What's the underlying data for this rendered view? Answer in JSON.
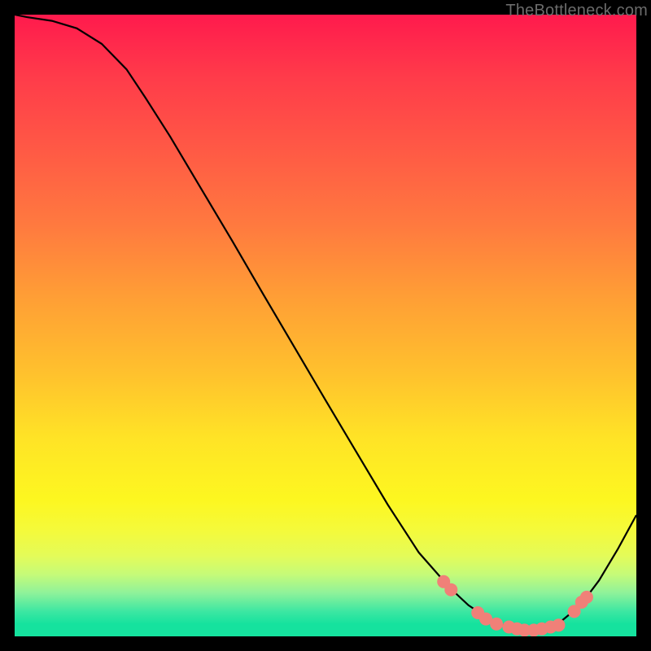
{
  "watermark": "TheBottleneck.com",
  "colors": {
    "background": "#000000",
    "gradient_top": "#ff1a4d",
    "gradient_bottom": "#15e29e",
    "curve_stroke": "#000000",
    "marker_fill": "#f08078"
  },
  "chart_data": {
    "type": "line",
    "title": "",
    "xlabel": "",
    "ylabel": "",
    "xlim": [
      0,
      1
    ],
    "ylim": [
      0,
      1
    ],
    "curve": [
      {
        "x": 0.0,
        "y": 1.0
      },
      {
        "x": 0.02,
        "y": 0.996
      },
      {
        "x": 0.06,
        "y": 0.99
      },
      {
        "x": 0.1,
        "y": 0.978
      },
      {
        "x": 0.14,
        "y": 0.953
      },
      {
        "x": 0.18,
        "y": 0.912
      },
      {
        "x": 0.21,
        "y": 0.867
      },
      {
        "x": 0.25,
        "y": 0.804
      },
      {
        "x": 0.3,
        "y": 0.72
      },
      {
        "x": 0.35,
        "y": 0.636
      },
      {
        "x": 0.4,
        "y": 0.55
      },
      {
        "x": 0.45,
        "y": 0.465
      },
      {
        "x": 0.5,
        "y": 0.38
      },
      {
        "x": 0.55,
        "y": 0.296
      },
      {
        "x": 0.6,
        "y": 0.212
      },
      {
        "x": 0.65,
        "y": 0.135
      },
      {
        "x": 0.7,
        "y": 0.078
      },
      {
        "x": 0.73,
        "y": 0.05
      },
      {
        "x": 0.76,
        "y": 0.03
      },
      {
        "x": 0.79,
        "y": 0.016
      },
      {
        "x": 0.82,
        "y": 0.01
      },
      {
        "x": 0.85,
        "y": 0.012
      },
      {
        "x": 0.88,
        "y": 0.025
      },
      {
        "x": 0.91,
        "y": 0.05
      },
      {
        "x": 0.94,
        "y": 0.09
      },
      {
        "x": 0.97,
        "y": 0.14
      },
      {
        "x": 1.0,
        "y": 0.195
      }
    ],
    "markers": [
      {
        "x": 0.69,
        "y": 0.088
      },
      {
        "x": 0.702,
        "y": 0.075
      },
      {
        "x": 0.745,
        "y": 0.038
      },
      {
        "x": 0.758,
        "y": 0.028
      },
      {
        "x": 0.775,
        "y": 0.02
      },
      {
        "x": 0.795,
        "y": 0.015
      },
      {
        "x": 0.808,
        "y": 0.012
      },
      {
        "x": 0.82,
        "y": 0.01
      },
      {
        "x": 0.835,
        "y": 0.01
      },
      {
        "x": 0.848,
        "y": 0.012
      },
      {
        "x": 0.862,
        "y": 0.015
      },
      {
        "x": 0.875,
        "y": 0.018
      },
      {
        "x": 0.9,
        "y": 0.04
      },
      {
        "x": 0.912,
        "y": 0.055
      },
      {
        "x": 0.92,
        "y": 0.063
      }
    ],
    "marker_radius_px": 8
  }
}
